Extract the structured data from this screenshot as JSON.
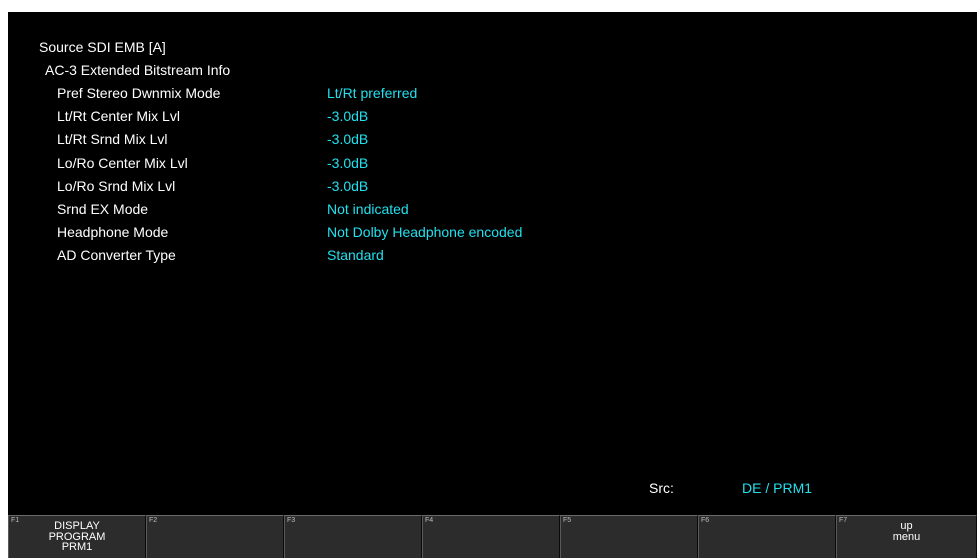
{
  "header": {
    "source_title": "Source SDI EMB [A]",
    "section_title": "AC-3 Extended Bitstream Info"
  },
  "info_rows": [
    {
      "label": "Pref Stereo Dwnmix Mode",
      "value": "Lt/Rt preferred"
    },
    {
      "label": "Lt/Rt Center Mix Lvl",
      "value": "-3.0dB"
    },
    {
      "label": "Lt/Rt Srnd Mix Lvl",
      "value": "-3.0dB"
    },
    {
      "label": "Lo/Ro Center Mix Lvl",
      "value": "-3.0dB"
    },
    {
      "label": "Lo/Ro Srnd Mix Lvl",
      "value": "-3.0dB"
    },
    {
      "label": "Srnd EX Mode",
      "value": "Not indicated"
    },
    {
      "label": "Headphone Mode",
      "value": "Not Dolby Headphone encoded"
    },
    {
      "label": "AD Converter Type",
      "value": "Standard"
    }
  ],
  "status": {
    "src_label": "Src:",
    "src_value": "DE / PRM1"
  },
  "function_keys": [
    {
      "num": "F1",
      "lines": [
        "DISPLAY",
        "PROGRAM",
        "PRM1"
      ]
    },
    {
      "num": "F2",
      "lines": []
    },
    {
      "num": "F3",
      "lines": []
    },
    {
      "num": "F4",
      "lines": []
    },
    {
      "num": "F5",
      "lines": []
    },
    {
      "num": "F6",
      "lines": []
    },
    {
      "num": "F7",
      "lines": [
        "up",
        "menu"
      ]
    }
  ],
  "colors": {
    "background": "#000000",
    "label_text": "#ffffff",
    "value_text": "#22e0ee",
    "fkey_background": "#2c2c2c"
  }
}
